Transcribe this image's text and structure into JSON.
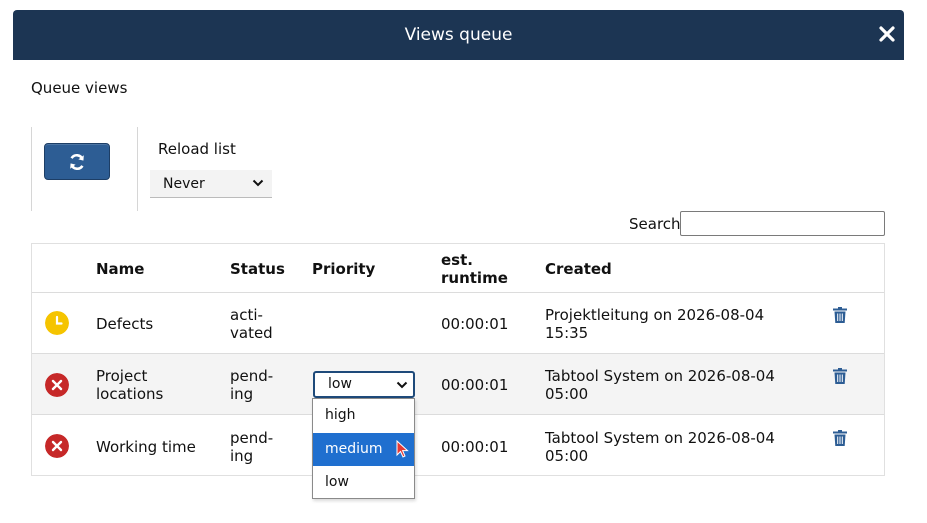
{
  "dialog": {
    "title": "Views queue"
  },
  "section": {
    "title": "Queue views"
  },
  "controls": {
    "reload_label": "Reload list",
    "reload_value": "Never",
    "search_label": "Search",
    "search_value": ""
  },
  "table": {
    "headers": {
      "name": "Name",
      "status": "Status",
      "priority": "Priority",
      "runtime_line1": "est.",
      "runtime_line2": "runtime",
      "created": "Created"
    },
    "rows": [
      {
        "icon": "clock-icon",
        "name_line1": "Defects",
        "name_line2": "",
        "status_line1": "acti-",
        "status_line2": "vated",
        "priority": "",
        "runtime": "00:00:01",
        "created_line1": "Projektleitung on 2026-08-04",
        "created_line2": "15:35"
      },
      {
        "icon": "error-icon",
        "name_line1": "Project",
        "name_line2": "locations",
        "status_line1": "pend-",
        "status_line2": "ing",
        "priority": "low",
        "runtime": "00:00:01",
        "created_line1": "Tabtool System on 2026-08-04",
        "created_line2": "05:00"
      },
      {
        "icon": "error-icon",
        "name_line1": "Working time",
        "name_line2": "",
        "status_line1": "pend-",
        "status_line2": "ing",
        "priority": "",
        "runtime": "00:00:01",
        "created_line1": "Tabtool System on 2026-08-04",
        "created_line2": "05:00"
      }
    ]
  },
  "priority_dropdown": {
    "options": [
      "high",
      "medium",
      "low"
    ],
    "highlighted": "medium"
  },
  "colors": {
    "header": "#1c3553",
    "accent": "#2d5d94",
    "pending": "#c62828",
    "active": "#f5c400",
    "highlight": "#1f6fcf"
  }
}
